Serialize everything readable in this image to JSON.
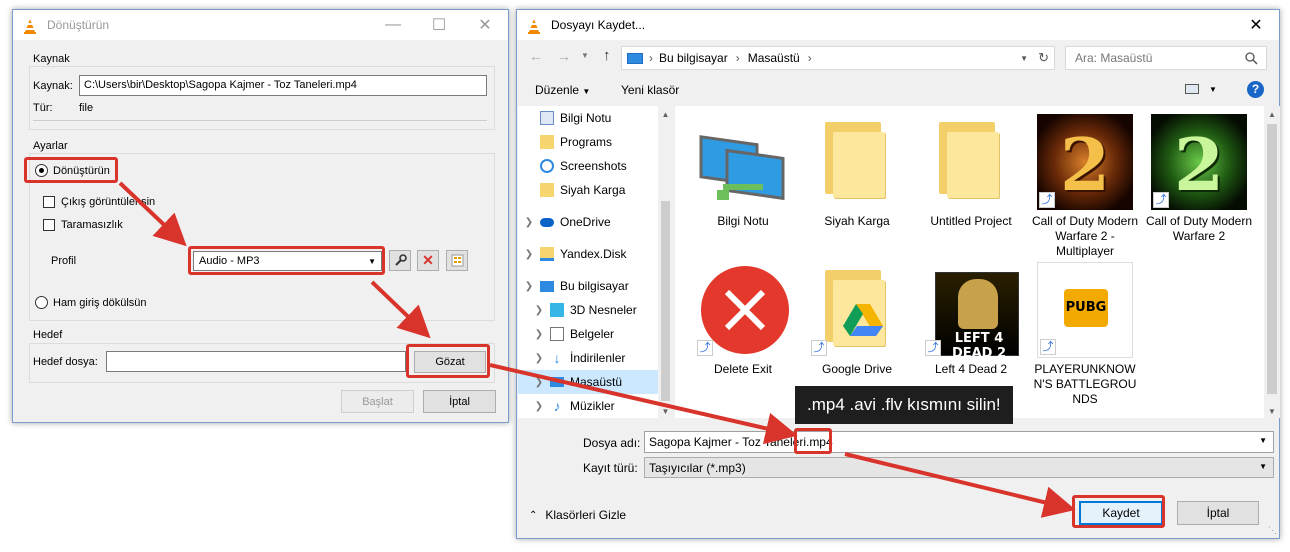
{
  "vlc_window": {
    "title": "Dönüştürün",
    "source": {
      "group": "Kaynak",
      "label": "Kaynak:",
      "path": "C:\\Users\\bir\\Desktop\\Sagopa Kajmer - Toz Taneleri.mp4",
      "type_label": "Tür:",
      "type_value": "file"
    },
    "settings": {
      "group": "Ayarlar",
      "convert_label": "Dönüştürün",
      "show_output_label": "Çıkış görüntülensin",
      "deinterlace_label": "Taramasızlık",
      "profile_label": "Profil",
      "profile_value": "Audio - MP3",
      "raw_dump_label": "Ham giriş dökülsün"
    },
    "destination": {
      "group": "Hedef",
      "file_label": "Hedef dosya:",
      "browse_label": "Gözat"
    },
    "start_label": "Başlat",
    "cancel_label": "İptal"
  },
  "save_dialog": {
    "title": "Dosyayı Kaydet...",
    "breadcrumb": [
      "Bu bilgisayar",
      "Masaüstü"
    ],
    "search_placeholder": "Ara: Masaüstü",
    "organize_label": "Düzenle",
    "new_folder_label": "Yeni klasör",
    "sidebar": [
      {
        "label": "Bilgi Notu",
        "icon": "document-icon"
      },
      {
        "label": "Programs",
        "icon": "folder-icon"
      },
      {
        "label": "Screenshots",
        "icon": "screenshot-icon"
      },
      {
        "label": "Siyah Karga",
        "icon": "folder-icon"
      },
      {
        "label": "OneDrive",
        "icon": "cloud-icon"
      },
      {
        "label": "Yandex.Disk",
        "icon": "yandex-icon"
      },
      {
        "label": "Bu bilgisayar",
        "icon": "computer-icon"
      },
      {
        "label": "3D Nesneler",
        "icon": "cube-icon"
      },
      {
        "label": "Belgeler",
        "icon": "documents-icon"
      },
      {
        "label": "İndirilenler",
        "icon": "download-icon"
      },
      {
        "label": "Masaüstü",
        "icon": "desktop-icon"
      },
      {
        "label": "Müzikler",
        "icon": "music-icon"
      }
    ],
    "files": [
      {
        "label": "Bilgi Notu",
        "icon": "network-icon"
      },
      {
        "label": "Siyah Karga",
        "icon": "folder-icon"
      },
      {
        "label": "Untitled Project",
        "icon": "folder-icon"
      },
      {
        "label": "Call of Duty Modern Warfare 2 - Multiplayer",
        "icon": "game-icon"
      },
      {
        "label": "Call of Duty Modern Warfare 2",
        "icon": "game-icon"
      },
      {
        "label": "Delete Exit",
        "icon": "error-icon"
      },
      {
        "label": "Google Drive",
        "icon": "drive-icon"
      },
      {
        "label": "Left 4 Dead 2",
        "icon": "game-icon"
      },
      {
        "label": "PLAYERUNKNOWN'S BATTLEGROUNDS",
        "icon": "game-icon"
      }
    ],
    "file_name_label": "Dosya adı:",
    "file_name_value": "Sagopa Kajmer - Toz Taneleri.mp4",
    "type_label": "Kayıt türü:",
    "type_value": "Taşıyıcılar (*.mp3)",
    "hide_folders_label": "Klasörleri Gizle",
    "save_label": "Kaydet",
    "cancel_label": "İptal"
  },
  "tooltip": ".mp4 .avi .flv kısmını silin!",
  "colors": {
    "highlight": "#d9342b",
    "selection": "#cce8ff",
    "accent": "#0078d7"
  }
}
